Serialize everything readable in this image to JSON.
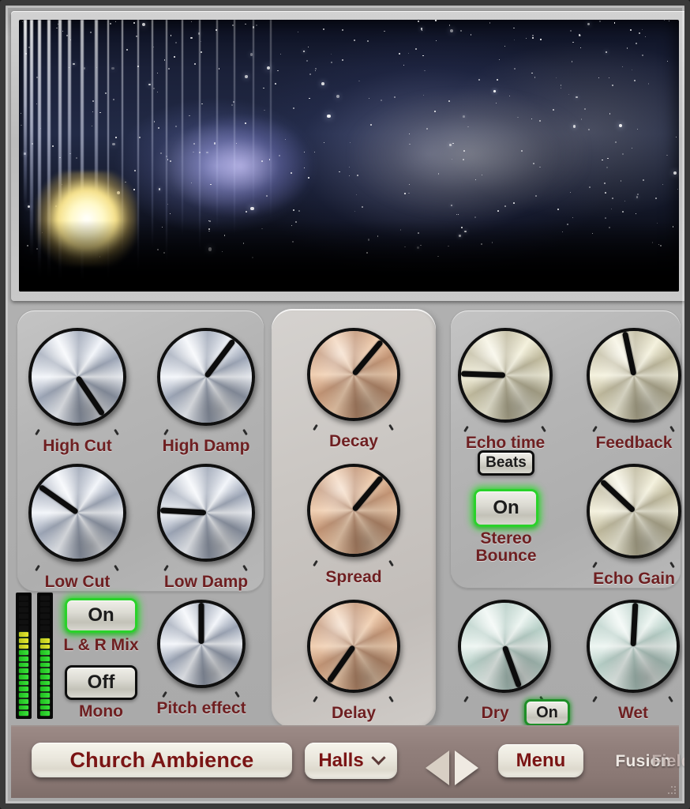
{
  "app": {
    "brand": "Fusion",
    "brand_ghost": "Field",
    "colors": {
      "label_red": "#6e1f21",
      "preset_text_red": "#7a1414",
      "toggle_on_green": "#2ad22a",
      "body_grey": "#aeaeae",
      "bottom_bar": "#8a7874"
    }
  },
  "header": {
    "artwork_name": "starfield-nebula-artwork"
  },
  "panels": {
    "left": {
      "name": "filter-panel",
      "knobs": [
        {
          "label": "High Cut",
          "angle": 146,
          "color": "silver"
        },
        {
          "label": "High Damp",
          "angle": 37,
          "color": "silver"
        },
        {
          "label": "Low Cut",
          "angle": 305,
          "color": "silver"
        },
        {
          "label": "Low Damp",
          "angle": 273,
          "color": "silver"
        }
      ],
      "meters": [
        {
          "name": "vu-meter-left",
          "segments_lit": 14,
          "segments_total": 20
        },
        {
          "name": "vu-meter-right",
          "segments_lit": 13,
          "segments_total": 20
        }
      ],
      "toggles": [
        {
          "label": "On",
          "caption": "L & R Mix",
          "state": "on"
        },
        {
          "label": "Off",
          "caption": "Mono",
          "state": "off"
        }
      ],
      "pitch_knob": {
        "label": "Pitch effect",
        "angle": 0,
        "color": "silver"
      }
    },
    "center": {
      "name": "reverb-panel",
      "knobs": [
        {
          "label": "Decay",
          "angle": 40,
          "color": "copper"
        },
        {
          "label": "Spread",
          "angle": 40,
          "color": "copper"
        },
        {
          "label": "Delay",
          "angle": 215,
          "color": "copper"
        }
      ]
    },
    "right": {
      "name": "echo-panel",
      "knobs": [
        {
          "label": "Echo time",
          "angle": 272,
          "color": "cream"
        },
        {
          "label": "Feedback",
          "angle": 348,
          "color": "cream"
        },
        {
          "label": "Echo Gain",
          "angle": 313,
          "color": "cream"
        }
      ],
      "beats_button": {
        "label": "Beats"
      },
      "stereo_bounce": {
        "label": "On",
        "caption_line1": "Stereo",
        "caption_line2": "Bounce",
        "state": "on"
      },
      "mix_knobs": [
        {
          "label": "Dry",
          "angle": 160,
          "color": "mint"
        },
        {
          "label": "Wet",
          "angle": 3,
          "color": "mint"
        }
      ],
      "mix_toggle": {
        "label": "On",
        "state": "on"
      }
    }
  },
  "bottom_bar": {
    "preset_name": "Church Ambience",
    "category": "Halls",
    "menu_label": "Menu",
    "prev_label": "",
    "next_label": ""
  }
}
